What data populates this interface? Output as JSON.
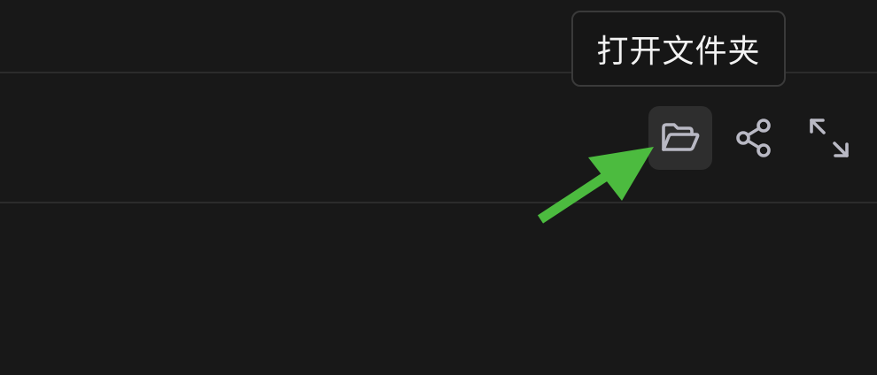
{
  "tooltip": {
    "text": "打开文件夹"
  },
  "toolbar": {
    "buttons": [
      {
        "name": "open-folder",
        "icon": "folder-open-icon",
        "active": true
      },
      {
        "name": "share",
        "icon": "share-icon",
        "active": false
      },
      {
        "name": "expand",
        "icon": "expand-icon",
        "active": false
      }
    ]
  },
  "colors": {
    "background": "#181818",
    "divider": "#2c2c2c",
    "icon": "#b9b9c4",
    "active_button": "#2e2e2e",
    "annotation_arrow": "#4cbb3f"
  }
}
